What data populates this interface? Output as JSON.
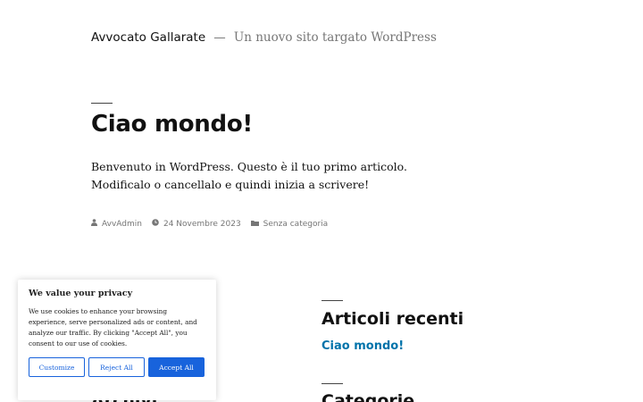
{
  "header": {
    "site_title": "Avvocato Gallarate",
    "separator": "—",
    "tagline": "Un nuovo sito targato WordPress"
  },
  "post": {
    "title": "Ciao mondo!",
    "content_line1": "Benvenuto in WordPress. Questo è il tuo primo articolo.",
    "content_line2": "Modificalo o cancellalo e quindi inizia a scrivere!",
    "meta": {
      "author": "AvvAdmin",
      "date": "24 Novembre 2023",
      "category": "Senza categoria"
    }
  },
  "widgets": {
    "recent_posts_heading": "Articoli recenti",
    "recent_posts_items": [
      "Ciao mondo!"
    ],
    "archives_heading": "Archivi",
    "categories_heading": "Categorie"
  },
  "cookie_banner": {
    "title": "We value your privacy",
    "text": "We use cookies to enhance your browsing experience, serve personalized ads or content, and analyze our traffic. By clicking \"Accept All\", you consent to our use of cookies.",
    "customize_label": "Customize",
    "reject_label": "Reject All",
    "accept_label": "Accept All"
  },
  "colors": {
    "link": "#0073aa",
    "cookie_accent": "#1863dc",
    "meta_text": "#767676"
  }
}
